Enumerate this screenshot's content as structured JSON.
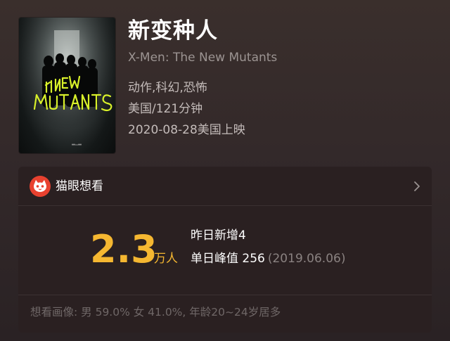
{
  "movie": {
    "title": "新变种人",
    "english_title": "X-Men: The New Mutants",
    "genres": "动作,科幻,恐怖",
    "country_duration": "美国/121分钟",
    "release": "2020-08-28美国上映",
    "poster": {
      "title_line1": "THE NEW",
      "title_line2": "MUTANTS",
      "accent_color": "#d8f02a"
    }
  },
  "want_card": {
    "brand_label": "猫眼想看",
    "brand_icon": "maoyan-cat-icon",
    "chevron_icon": "chevron-right-icon",
    "count": "2.3",
    "count_unit": "万人",
    "yesterday_text": "昨日新增4",
    "peak_label": "单日峰值 256",
    "peak_date": "(2019.06.06)",
    "portrait_text": "想看画像: 男 59.0%  女 41.0%,  年龄20~24岁居多",
    "colors": {
      "accent": "#f5b731",
      "brand_red": "#e8412f"
    }
  }
}
